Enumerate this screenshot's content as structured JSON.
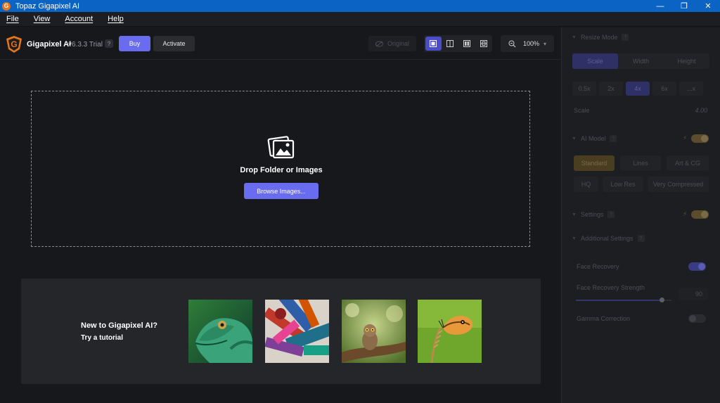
{
  "window": {
    "title": "Topaz Gigapixel AI",
    "controls": {
      "minimize": "—",
      "restore": "❐",
      "close": "✕"
    }
  },
  "menu": [
    "File",
    "View",
    "Account",
    "Help"
  ],
  "toolbar": {
    "brand": "Gigapixel AI",
    "version": "v6.3.3 Trial",
    "help": "?",
    "buy": "Buy",
    "activate": "Activate",
    "original": "Original",
    "zoom": "100%"
  },
  "dropzone": {
    "title": "Drop Folder or Images",
    "browse": "Browse Images..."
  },
  "tutorial": {
    "line1": "New to Gigapixel AI?",
    "line2": "Try a tutorial",
    "thumbnails": [
      "lizard",
      "paint-brushes",
      "owl",
      "butterfly"
    ]
  },
  "panel": {
    "resize_mode": {
      "header": "Resize Mode",
      "help": "?",
      "tabs": [
        "Scale",
        "Width",
        "Height"
      ],
      "active_tab": "Scale",
      "scales": [
        "0.5x",
        "2x",
        "4x",
        "6x",
        "...x"
      ],
      "active_scale": "4x",
      "scale_label": "Scale",
      "scale_value": "4.00"
    },
    "ai_model": {
      "header": "AI Model",
      "help": "?",
      "row1": [
        "Standard",
        "Lines",
        "Art & CG"
      ],
      "row2": [
        "HQ",
        "Low Res",
        "Very Compressed"
      ],
      "active": "Standard"
    },
    "settings": {
      "header": "Settings",
      "help": "?"
    },
    "additional": {
      "header": "Additional Settings",
      "help": "?",
      "face_recovery": "Face Recovery",
      "face_recovery_strength": "Face Recovery Strength",
      "strength_value": "90",
      "strength_fraction": 0.9,
      "gamma_correction": "Gamma Correction"
    }
  },
  "colors": {
    "accent": "#6a6cf0",
    "titlebar": "#0b63c4",
    "background": "#17181b",
    "panel": "#1d1e21"
  }
}
